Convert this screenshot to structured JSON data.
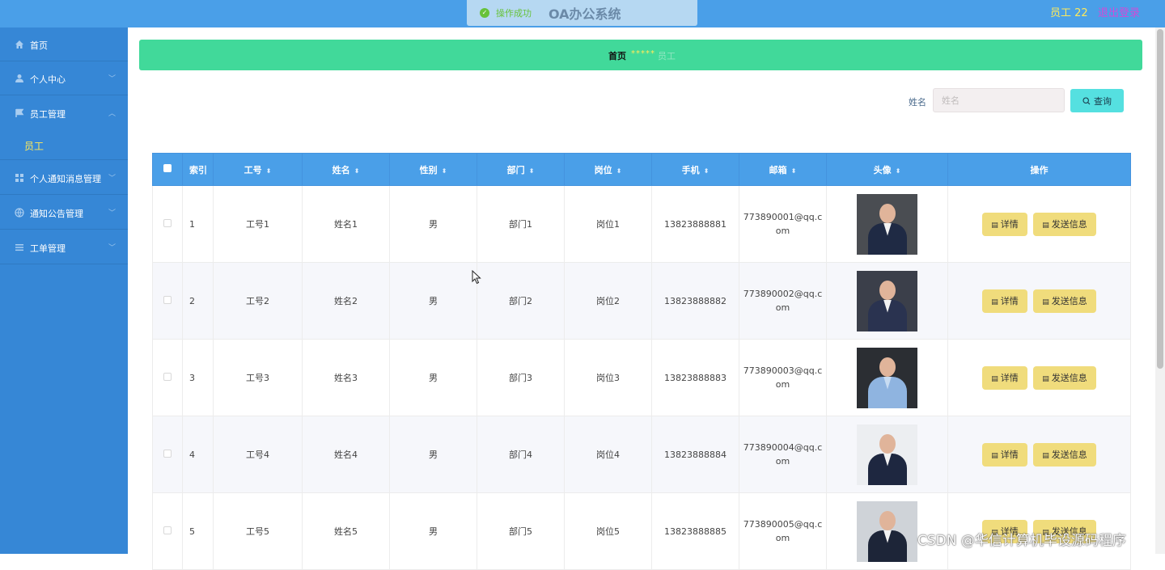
{
  "header": {
    "toast": "操作成功",
    "title": "OA办公系统",
    "user": "员工 22",
    "logout": "退出登录"
  },
  "sidebar": {
    "items": [
      {
        "label": "首页",
        "icon": "home-icon"
      },
      {
        "label": "个人中心",
        "icon": "user-icon"
      },
      {
        "label": "员工管理",
        "icon": "flag-icon"
      },
      {
        "label": "个人通知消息管理",
        "icon": "grid-icon"
      },
      {
        "label": "通知公告管理",
        "icon": "globe-icon"
      },
      {
        "label": "工单管理",
        "icon": "list-icon"
      }
    ],
    "sub_item": "员工"
  },
  "breadcrumb": {
    "home": "首页",
    "separator": "*****",
    "current": "员工"
  },
  "search": {
    "label": "姓名",
    "placeholder": "姓名",
    "button": "查询"
  },
  "table": {
    "columns": [
      "索引",
      "工号",
      "姓名",
      "性别",
      "部门",
      "岗位",
      "手机",
      "邮箱",
      "头像",
      "操作"
    ],
    "rows": [
      {
        "index": "1",
        "emp_no": "工号1",
        "name": "姓名1",
        "gender": "男",
        "dept": "部门1",
        "post": "岗位1",
        "phone": "13823888881",
        "email": "773890001@qq.com"
      },
      {
        "index": "2",
        "emp_no": "工号2",
        "name": "姓名2",
        "gender": "男",
        "dept": "部门2",
        "post": "岗位2",
        "phone": "13823888882",
        "email": "773890002@qq.com"
      },
      {
        "index": "3",
        "emp_no": "工号3",
        "name": "姓名3",
        "gender": "男",
        "dept": "部门3",
        "post": "岗位3",
        "phone": "13823888883",
        "email": "773890003@qq.com"
      },
      {
        "index": "4",
        "emp_no": "工号4",
        "name": "姓名4",
        "gender": "男",
        "dept": "部门4",
        "post": "岗位4",
        "phone": "13823888884",
        "email": "773890004@qq.com"
      },
      {
        "index": "5",
        "emp_no": "工号5",
        "name": "姓名5",
        "gender": "男",
        "dept": "部门5",
        "post": "岗位5",
        "phone": "13823888885",
        "email": "773890005@qq.com"
      }
    ],
    "actions": {
      "detail": "详情",
      "send": "发送信息"
    }
  },
  "watermark": "CSDN @华信计算机毕设源码程序",
  "colors": {
    "topbar": "#4a9fe8",
    "sidebar": "#3687d6",
    "banner": "#41d99a",
    "action_button": "#f0dc7c",
    "search_button": "#55e0e0"
  }
}
